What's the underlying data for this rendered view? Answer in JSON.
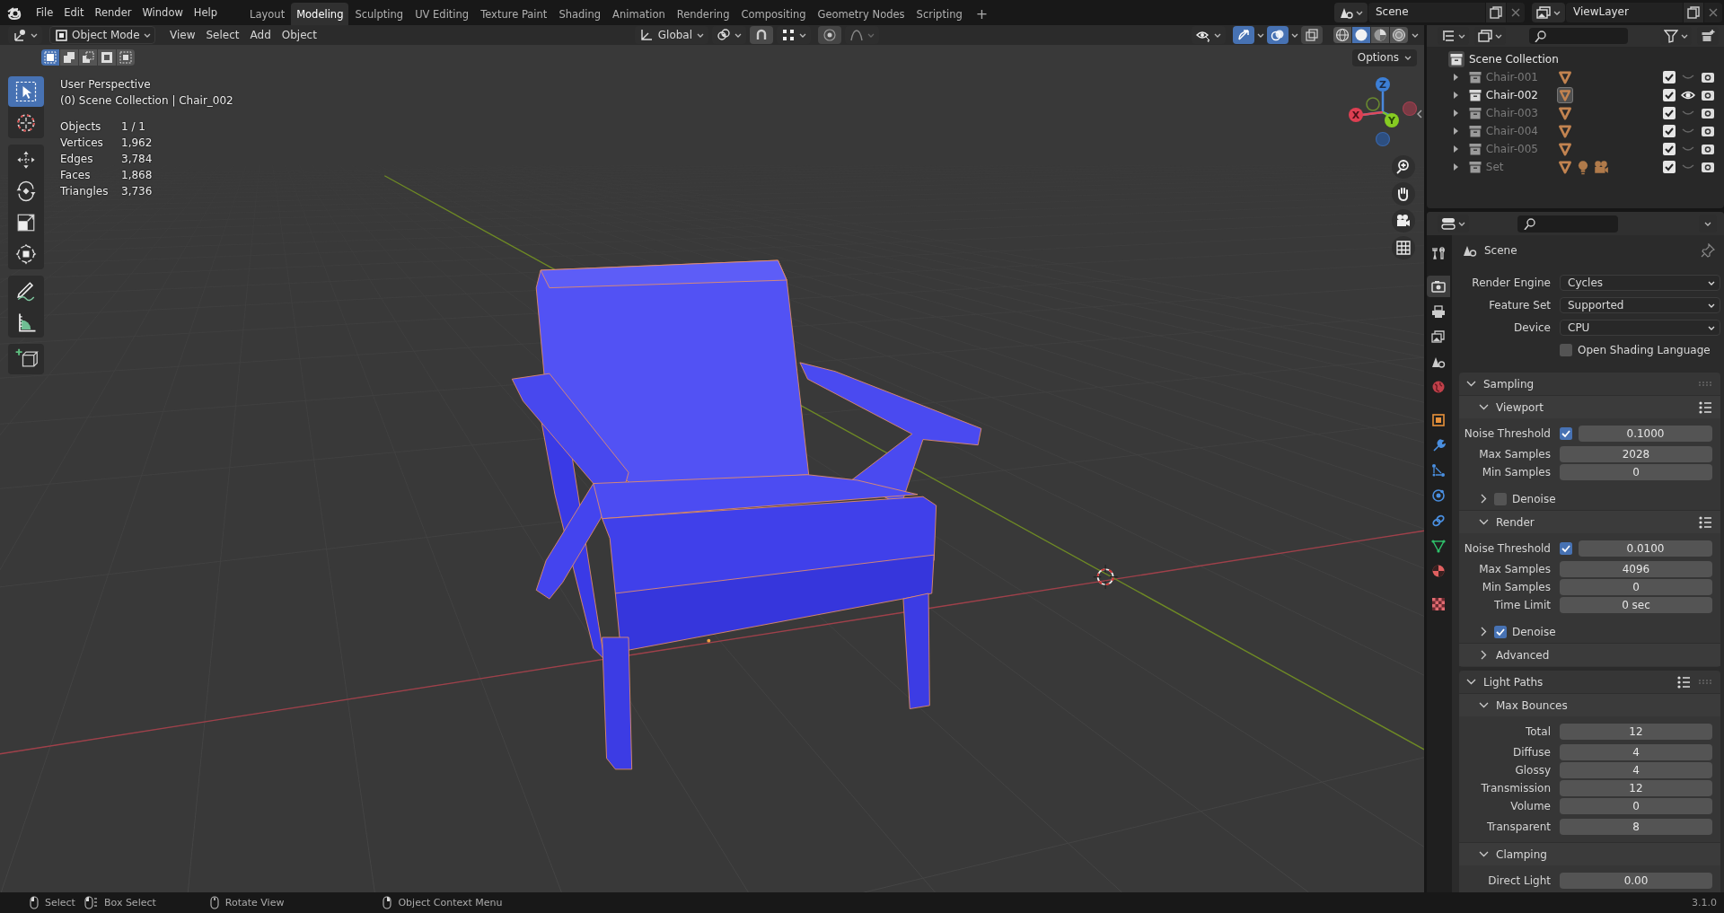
{
  "top_bar": {
    "menus": [
      "File",
      "Edit",
      "Render",
      "Window",
      "Help"
    ],
    "workspaces": [
      {
        "label": "Layout",
        "selected": false
      },
      {
        "label": "Modeling",
        "selected": true
      },
      {
        "label": "Sculpting",
        "selected": false
      },
      {
        "label": "UV Editing",
        "selected": false
      },
      {
        "label": "Texture Paint",
        "selected": false
      },
      {
        "label": "Shading",
        "selected": false
      },
      {
        "label": "Animation",
        "selected": false
      },
      {
        "label": "Rendering",
        "selected": false
      },
      {
        "label": "Compositing",
        "selected": false
      },
      {
        "label": "Geometry Nodes",
        "selected": false
      },
      {
        "label": "Scripting",
        "selected": false
      }
    ],
    "add_workspace": "+",
    "scene": "Scene",
    "view_layer": "ViewLayer"
  },
  "viewport": {
    "mode": "Object Mode",
    "menus": [
      "View",
      "Select",
      "Add",
      "Object"
    ],
    "orientation": "Global",
    "header_toggles": [
      {
        "kind": "gizmo",
        "on": true
      },
      {
        "kind": "overlay",
        "on": true
      },
      {
        "kind": "xray",
        "on": false
      }
    ],
    "shading": [
      {
        "kind": "wireframe",
        "selected": false
      },
      {
        "kind": "solid",
        "selected": true
      },
      {
        "kind": "material",
        "selected": false
      },
      {
        "kind": "rendered",
        "selected": false
      }
    ],
    "select_modes": [
      {
        "kind": "set",
        "selected": true
      },
      {
        "kind": "extend",
        "selected": false
      },
      {
        "kind": "subtract",
        "selected": false
      },
      {
        "kind": "invert",
        "selected": false
      },
      {
        "kind": "intersect",
        "selected": false
      }
    ],
    "options": "Options",
    "tool_groups": [
      [
        {
          "kind": "select_box",
          "selected": true
        },
        {
          "kind": "cursor",
          "selected": false
        }
      ],
      [
        {
          "kind": "move",
          "selected": false
        },
        {
          "kind": "rotate",
          "selected": false
        },
        {
          "kind": "scale",
          "selected": false
        },
        {
          "kind": "transform",
          "selected": false
        }
      ],
      [
        {
          "kind": "annotate",
          "selected": false
        },
        {
          "kind": "measure",
          "selected": false
        }
      ],
      [
        {
          "kind": "add_cube",
          "selected": false
        }
      ]
    ],
    "view_name": "User Perspective",
    "context": "(0) Scene Collection | Chair_002",
    "stats": [
      {
        "label": "Objects",
        "value": "1 / 1"
      },
      {
        "label": "Vertices",
        "value": "1,962"
      },
      {
        "label": "Edges",
        "value": "3,784"
      },
      {
        "label": "Faces",
        "value": "1,868"
      },
      {
        "label": "Triangles",
        "value": "3,736"
      }
    ],
    "gizmo": {
      "x": "X",
      "y": "Y",
      "z": "Z"
    }
  },
  "outliner": {
    "root": "Scene Collection",
    "collections": [
      {
        "name": "Chair-001",
        "checked": true,
        "visible": false,
        "contents": [
          {
            "kind": "mesh",
            "selected": false
          }
        ]
      },
      {
        "name": "Chair-002",
        "checked": true,
        "visible": true,
        "contents": [
          {
            "kind": "mesh",
            "selected": true
          }
        ]
      },
      {
        "name": "Chair-003",
        "checked": true,
        "visible": false,
        "contents": [
          {
            "kind": "mesh",
            "selected": false
          }
        ]
      },
      {
        "name": "Chair-004",
        "checked": true,
        "visible": false,
        "contents": [
          {
            "kind": "mesh",
            "selected": false
          }
        ]
      },
      {
        "name": "Chair-005",
        "checked": true,
        "visible": false,
        "contents": [
          {
            "kind": "mesh",
            "selected": false
          }
        ]
      },
      {
        "name": "Set",
        "checked": true,
        "visible": false,
        "contents": [
          {
            "kind": "mesh",
            "selected": false
          },
          {
            "kind": "light",
            "selected": false
          },
          {
            "kind": "camera",
            "selected": false
          }
        ]
      }
    ]
  },
  "properties": {
    "tab_groups": [
      [
        {
          "kind": "tool",
          "selected": false
        }
      ],
      [
        {
          "kind": "render",
          "selected": true
        },
        {
          "kind": "output",
          "selected": false
        },
        {
          "kind": "view_layer",
          "selected": false
        },
        {
          "kind": "scene",
          "selected": false
        },
        {
          "kind": "world",
          "selected": false
        }
      ],
      [
        {
          "kind": "object",
          "selected": false
        },
        {
          "kind": "modifiers",
          "selected": false
        },
        {
          "kind": "particles",
          "selected": false
        },
        {
          "kind": "physics",
          "selected": false
        },
        {
          "kind": "constraints",
          "selected": false
        },
        {
          "kind": "data",
          "selected": false
        },
        {
          "kind": "material",
          "selected": false
        }
      ],
      [
        {
          "kind": "texture",
          "selected": false
        }
      ]
    ],
    "context": "Scene",
    "groups": [
      [
        {
          "kind": "dropdown",
          "label": "Render Engine",
          "value": "Cycles"
        },
        {
          "kind": "dropdown",
          "label": "Feature Set",
          "value": "Supported"
        },
        {
          "kind": "dropdown",
          "label": "Device",
          "value": "CPU"
        },
        {
          "kind": "checkbox",
          "label": "Open Shading Language",
          "checked": false
        }
      ]
    ],
    "panels": [
      {
        "title": "Sampling",
        "expanded": true,
        "children": [
          {
            "title": "Viewport",
            "expanded": true,
            "presets": true,
            "groups": [
              [
                {
                  "kind": "check_number",
                  "label": "Noise Threshold",
                  "checked": true,
                  "value": "0.1000"
                }
              ],
              [
                {
                  "kind": "number",
                  "label": "Max Samples",
                  "value": "2028"
                },
                {
                  "kind": "number",
                  "label": "Min Samples",
                  "value": "0"
                }
              ]
            ],
            "children": [
              {
                "title": "Denoise",
                "expanded": false,
                "checked": false
              }
            ]
          },
          {
            "title": "Render",
            "expanded": true,
            "presets": true,
            "groups": [
              [
                {
                  "kind": "check_number",
                  "label": "Noise Threshold",
                  "checked": true,
                  "value": "0.0100"
                }
              ],
              [
                {
                  "kind": "number",
                  "label": "Max Samples",
                  "value": "4096"
                },
                {
                  "kind": "number",
                  "label": "Min Samples",
                  "value": "0"
                },
                {
                  "kind": "number",
                  "label": "Time Limit",
                  "value": "0 sec"
                }
              ]
            ],
            "children": [
              {
                "title": "Denoise",
                "expanded": false,
                "checked": true
              }
            ]
          },
          {
            "title": "Advanced",
            "expanded": false
          }
        ]
      },
      {
        "title": "Light Paths",
        "expanded": true,
        "presets": true,
        "children": [
          {
            "title": "Max Bounces",
            "expanded": true,
            "groups": [
              [
                {
                  "kind": "number",
                  "label": "Total",
                  "value": "12"
                }
              ],
              [
                {
                  "kind": "number",
                  "label": "Diffuse",
                  "value": "4"
                },
                {
                  "kind": "number",
                  "label": "Glossy",
                  "value": "4"
                },
                {
                  "kind": "number",
                  "label": "Transmission",
                  "value": "12"
                },
                {
                  "kind": "number",
                  "label": "Volume",
                  "value": "0"
                }
              ],
              [
                {
                  "kind": "number",
                  "label": "Transparent",
                  "value": "8"
                }
              ]
            ]
          },
          {
            "title": "Clamping",
            "expanded": true,
            "groups": [
              [
                {
                  "kind": "number",
                  "label": "Direct Light",
                  "value": "0.00"
                }
              ]
            ]
          }
        ]
      }
    ]
  },
  "status_bar": {
    "hints": [
      {
        "kind": "left",
        "label": "Select"
      },
      {
        "kind": "drag",
        "label": "Box Select"
      },
      {
        "kind": "middle",
        "label": "Rotate View"
      },
      {
        "kind": "right",
        "label": "Object Context Menu"
      }
    ],
    "version": "3.1.0"
  }
}
